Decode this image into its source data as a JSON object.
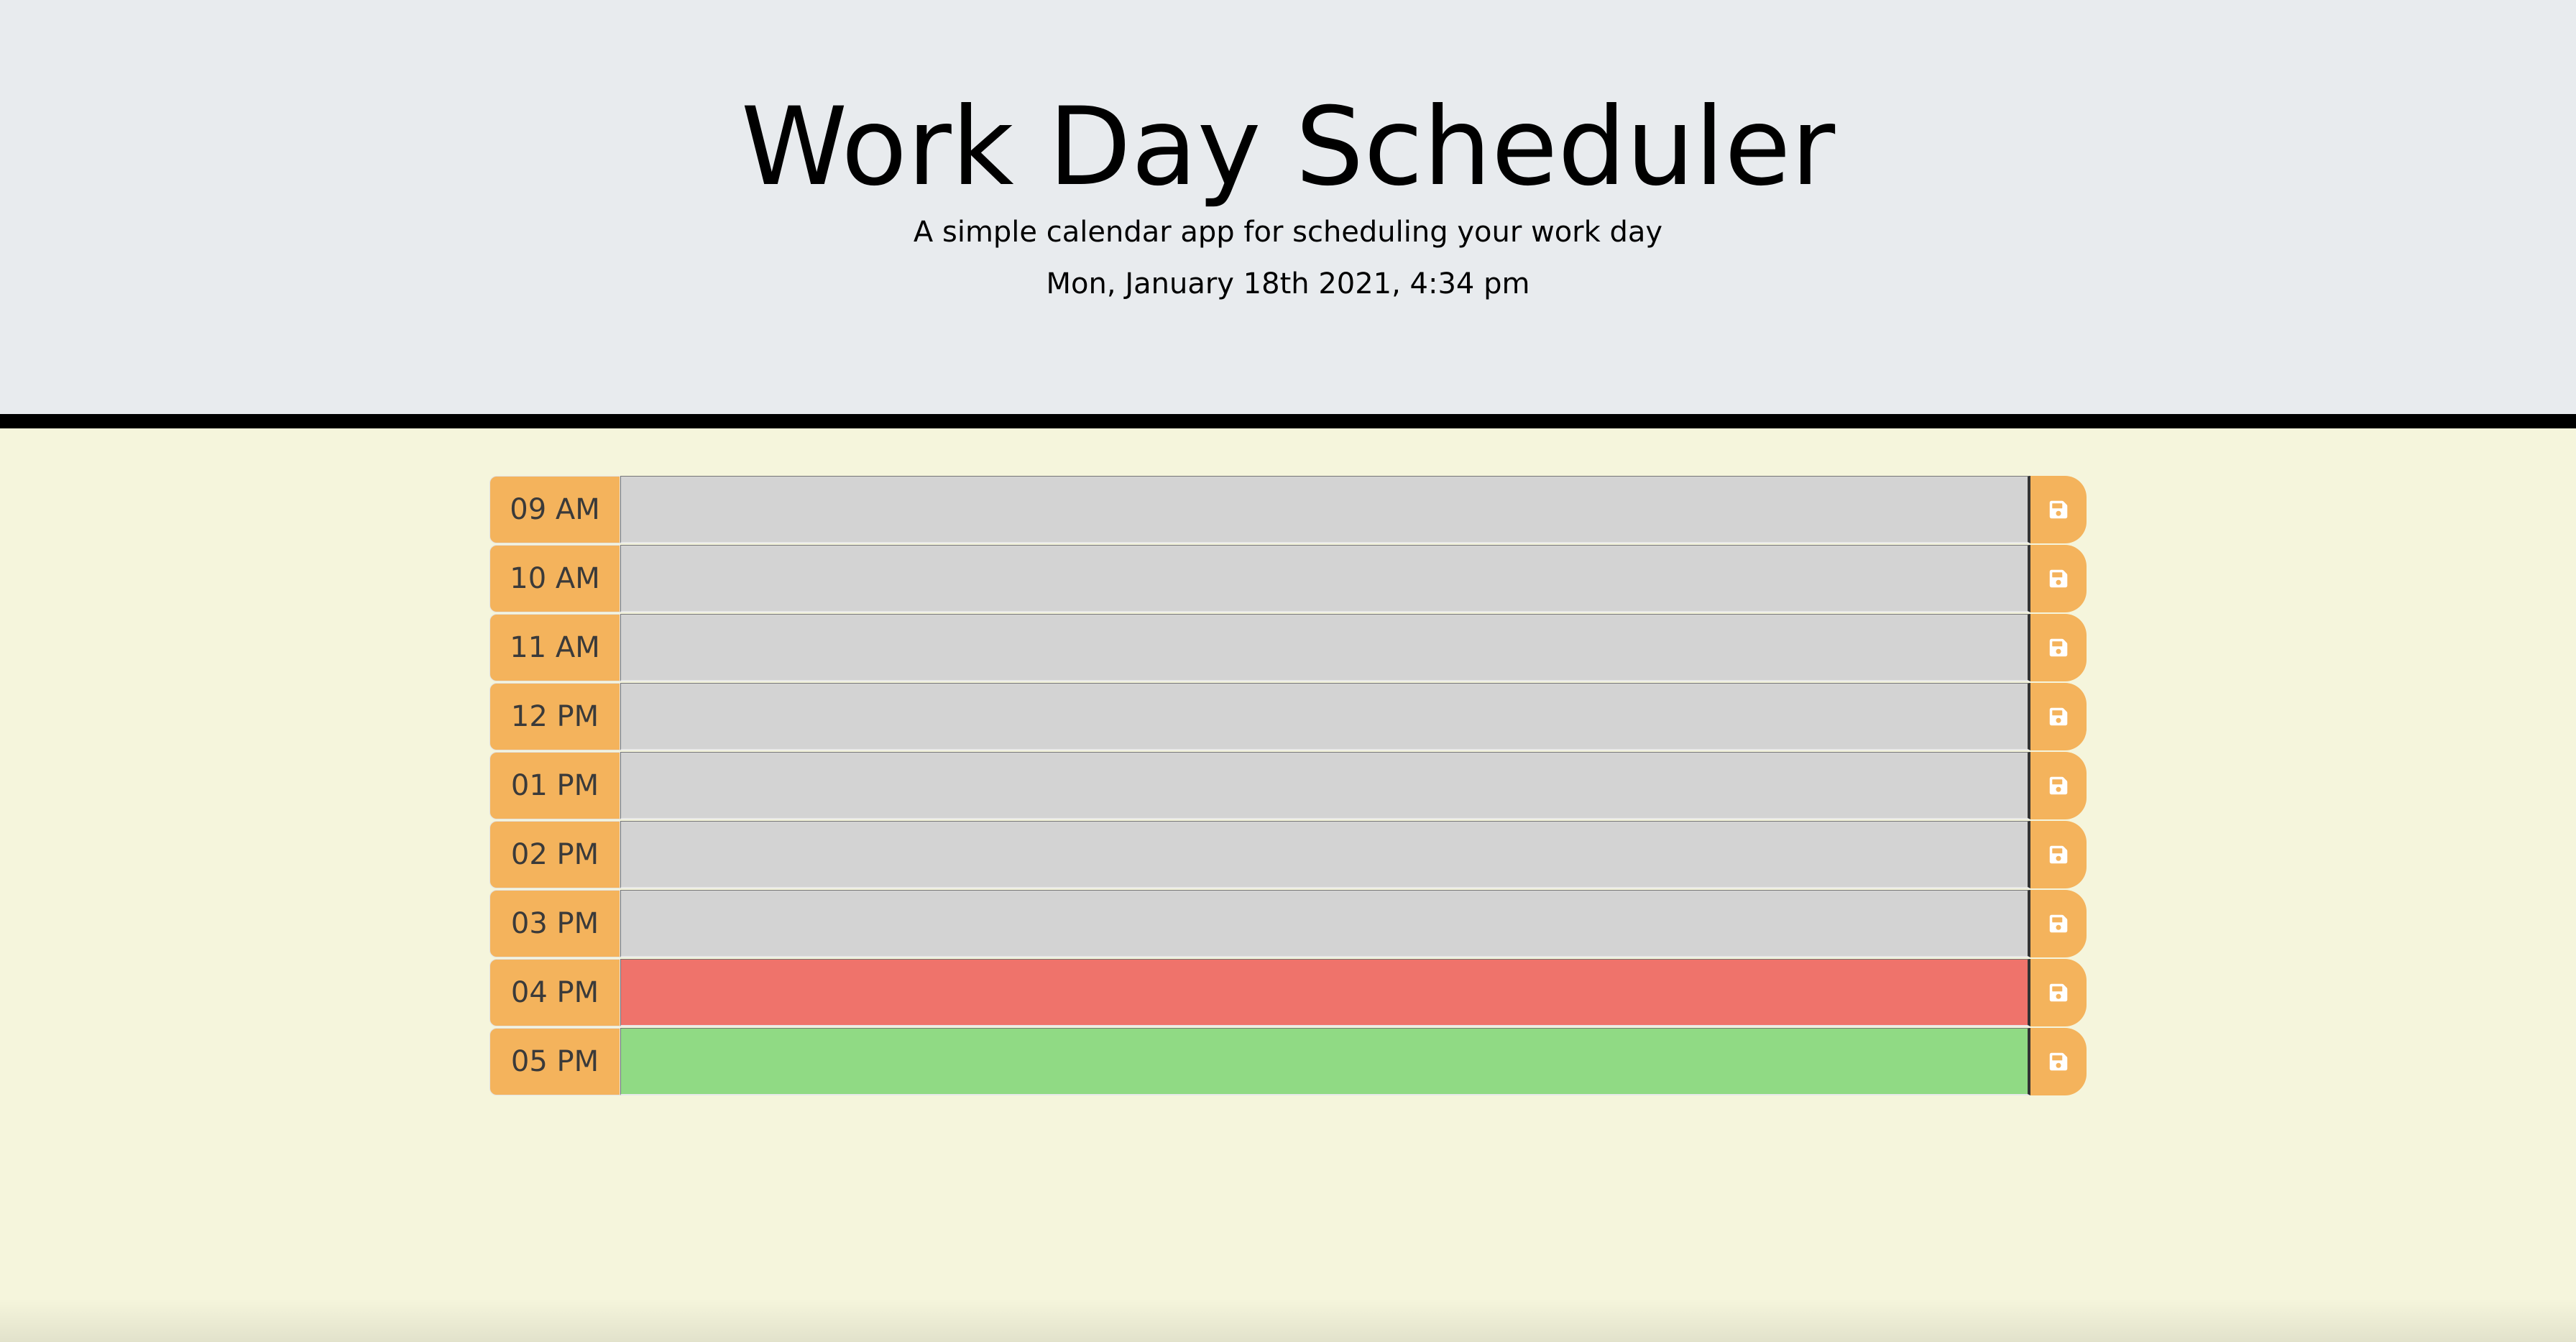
{
  "header": {
    "title": "Work Day Scheduler",
    "lead": "A simple calendar app for scheduling your work day",
    "current_date": "Mon, January 18th 2021, 4:34 pm"
  },
  "colors": {
    "header_bg": "#e8ebee",
    "page_bg": "#f5f5dc",
    "hour_bg": "#f4b35c",
    "past": "#d3d3d3",
    "present": "#ef736b",
    "future": "#90da84"
  },
  "save_icon": "save-icon",
  "timeblocks": [
    {
      "hour": "09 AM",
      "text": "",
      "state": "past"
    },
    {
      "hour": "10 AM",
      "text": "",
      "state": "past"
    },
    {
      "hour": "11 AM",
      "text": "",
      "state": "past"
    },
    {
      "hour": "12 PM",
      "text": "",
      "state": "past"
    },
    {
      "hour": "01 PM",
      "text": "",
      "state": "past"
    },
    {
      "hour": "02 PM",
      "text": "",
      "state": "past"
    },
    {
      "hour": "03 PM",
      "text": "",
      "state": "past"
    },
    {
      "hour": "04 PM",
      "text": "",
      "state": "present"
    },
    {
      "hour": "05 PM",
      "text": "",
      "state": "future"
    }
  ]
}
